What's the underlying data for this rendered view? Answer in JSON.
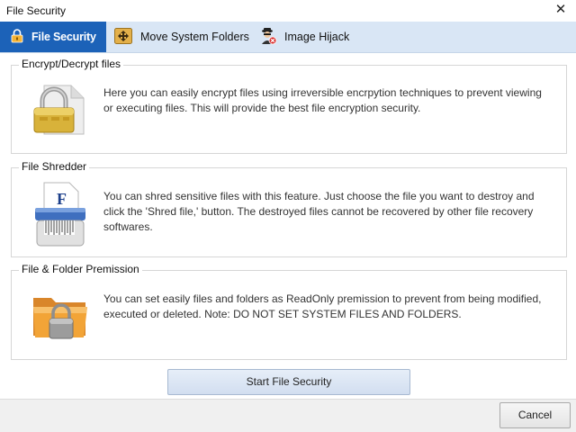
{
  "window": {
    "title": "File Security",
    "close_glyph": "✕"
  },
  "tabs": [
    {
      "label": "File Security",
      "icon": "lock-shield-icon",
      "active": true
    },
    {
      "label": "Move System Folders",
      "icon": "move-arrows-icon",
      "active": false
    },
    {
      "label": "Image Hijack",
      "icon": "hijacker-icon",
      "active": false
    }
  ],
  "sections": [
    {
      "title": "Encrypt/Decrypt files",
      "icon": "padlock-icon",
      "description": "Here you can easily encrypt files using irreversible encrpytion techniques to prevent viewing or executing files. This will provide the best file encryption security."
    },
    {
      "title": "File Shredder",
      "icon": "shredder-icon",
      "description": "You can shred sensitive files with this feature. Just choose the file you want to destroy and click the 'Shred file,' button. The destroyed files cannot be recovered by other file recovery softwares."
    },
    {
      "title": "File & Folder Premission",
      "icon": "locked-folder-icon",
      "description": "You can set easily files and folders as ReadOnly premission to prevent from being modified, executed or deleted. Note: DO NOT SET SYSTEM FILES AND FOLDERS."
    }
  ],
  "actions": {
    "start": "Start File Security",
    "cancel": "Cancel"
  },
  "colors": {
    "active_tab": "#1c62b8",
    "tab_bar": "#d9e6f5",
    "padlock": "#d8b23a",
    "folder": "#f2a437"
  }
}
